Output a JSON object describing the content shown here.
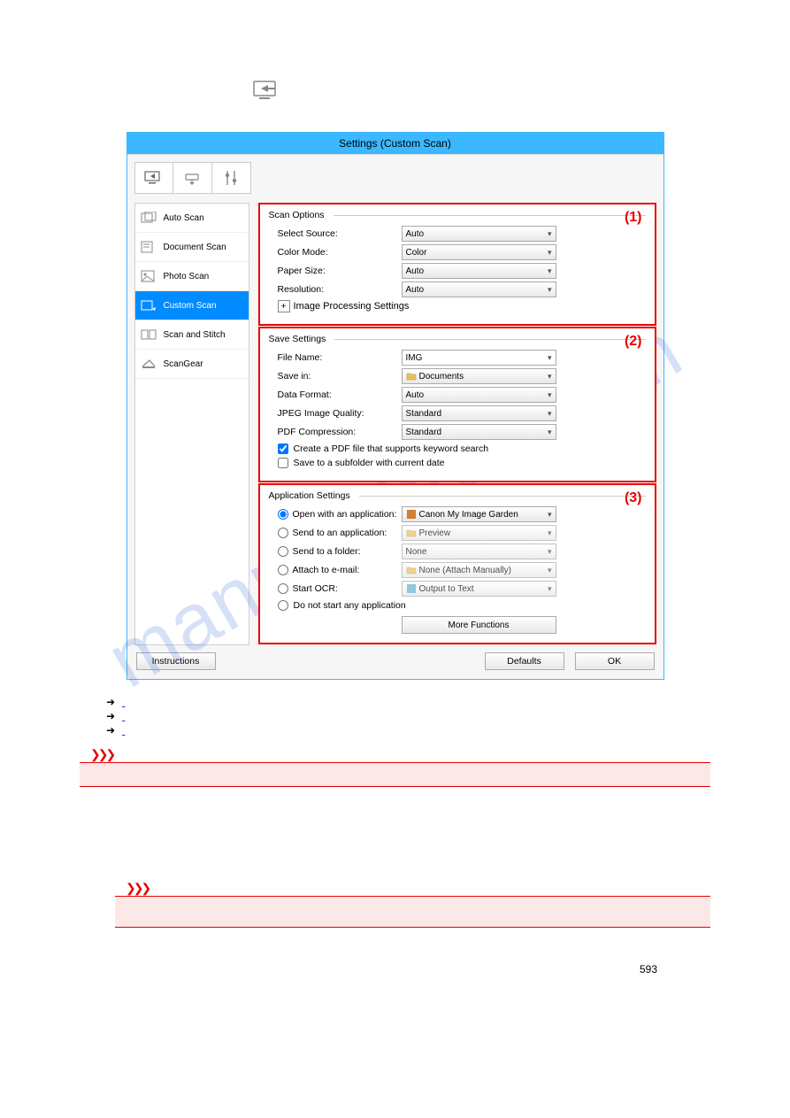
{
  "dialog": {
    "title": "Settings (Custom Scan)"
  },
  "sidebar": {
    "items": [
      {
        "label": "Auto Scan"
      },
      {
        "label": "Document Scan"
      },
      {
        "label": "Photo Scan"
      },
      {
        "label": "Custom Scan"
      },
      {
        "label": "Scan and Stitch"
      },
      {
        "label": "ScanGear"
      }
    ]
  },
  "scan_options": {
    "title": "Scan Options",
    "number": "(1)",
    "select_source_label": "Select Source:",
    "select_source_value": "Auto",
    "color_mode_label": "Color Mode:",
    "color_mode_value": "Color",
    "paper_size_label": "Paper Size:",
    "paper_size_value": "Auto",
    "resolution_label": "Resolution:",
    "resolution_value": "Auto",
    "image_processing_label": "Image Processing Settings"
  },
  "save_settings": {
    "title": "Save Settings",
    "number": "(2)",
    "file_name_label": "File Name:",
    "file_name_value": "IMG",
    "save_in_label": "Save in:",
    "save_in_value": "Documents",
    "data_format_label": "Data Format:",
    "data_format_value": "Auto",
    "jpeg_quality_label": "JPEG Image Quality:",
    "jpeg_quality_value": "Standard",
    "pdf_compression_label": "PDF Compression:",
    "pdf_compression_value": "Standard",
    "pdf_keyword_label": "Create a PDF file that supports keyword search",
    "subfolder_label": "Save to a subfolder with current date"
  },
  "app_settings": {
    "title": "Application Settings",
    "number": "(3)",
    "open_app_label": "Open with an application:",
    "open_app_value": "Canon My Image Garden",
    "send_app_label": "Send to an application:",
    "send_app_value": "Preview",
    "send_folder_label": "Send to a folder:",
    "send_folder_value": "None",
    "attach_email_label": "Attach to e-mail:",
    "attach_email_value": "None (Attach Manually)",
    "start_ocr_label": "Start OCR:",
    "start_ocr_value": "Output to Text",
    "no_app_label": "Do not start any application",
    "more_functions": "More Functions"
  },
  "footer": {
    "instructions": "Instructions",
    "defaults": "Defaults",
    "ok": "OK"
  },
  "page_number": "593"
}
